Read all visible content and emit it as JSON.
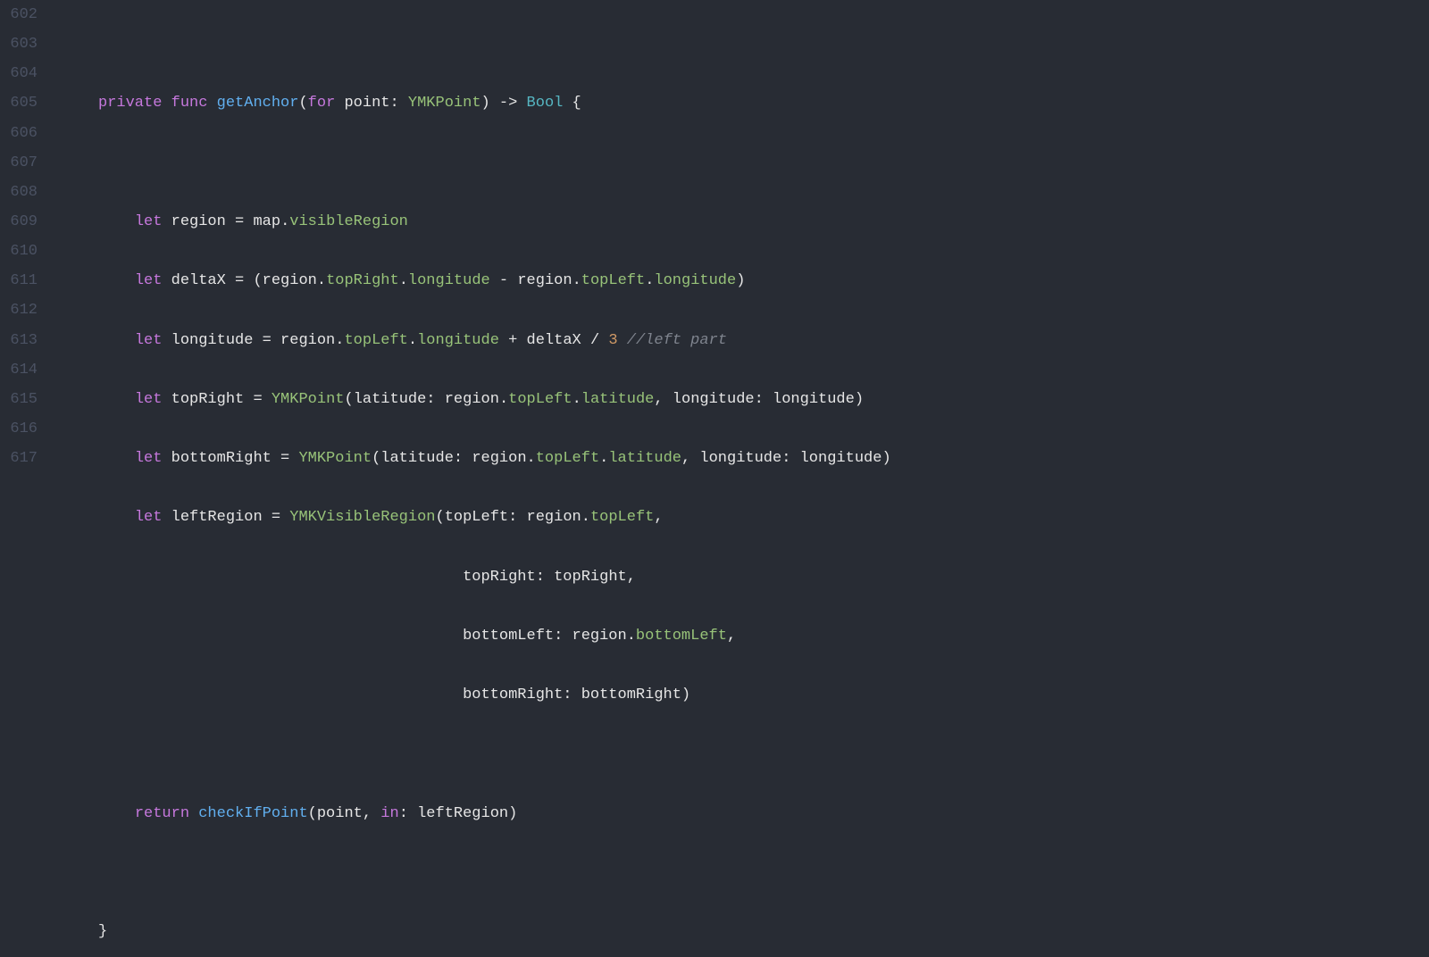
{
  "lineNumbers": [
    "602",
    "603",
    "604",
    "605",
    "606",
    "607",
    "608",
    "609",
    "610",
    "611",
    "612",
    "613",
    "614",
    "615",
    "616",
    "617"
  ],
  "tokens": {
    "l603": {
      "kw1": "private",
      "kw2": "func",
      "fn": "getAnchor",
      "p1": "(",
      "forKw": "for",
      "param": " point",
      "colon": ": ",
      "type1": "YMKPoint",
      "p2": ")",
      "arrow": " -> ",
      "type2": "Bool",
      "brace": " {"
    },
    "l605": {
      "let": "let",
      "name": " region ",
      "eq": "=",
      "obj": " map",
      "dot": ".",
      "prop": "visibleRegion"
    },
    "l606": {
      "let": "let",
      "name": " deltaX ",
      "eq": "=",
      "sp": " ",
      "p1": "(",
      "r1": "region",
      "d1": ".",
      "pr1": "topRight",
      "d2": ".",
      "pr2": "longitude",
      "minus": " - ",
      "r2": "region",
      "d3": ".",
      "pr3": "topLeft",
      "d4": ".",
      "pr4": "longitude",
      "p2": ")"
    },
    "l607": {
      "let": "let",
      "name": " longitude ",
      "eq": "=",
      "sp": " ",
      "r": "region",
      "d1": ".",
      "pr1": "topLeft",
      "d2": ".",
      "pr2": "longitude",
      "plus": " + ",
      "dx": "deltaX",
      "div": " / ",
      "num": "3",
      "sp2": " ",
      "comment": "//left part"
    },
    "l608": {
      "let": "let",
      "name": " topRight ",
      "eq": "= ",
      "type": "YMKPoint",
      "p1": "(",
      "lab1": "latitude: ",
      "r": "region",
      "d1": ".",
      "pr1": "topLeft",
      "d2": ".",
      "pr2": "latitude",
      "comma": ", ",
      "lab2": "longitude: ",
      "val": "longitude",
      "p2": ")"
    },
    "l609": {
      "let": "let",
      "name": " bottomRight ",
      "eq": "= ",
      "type": "YMKPoint",
      "p1": "(",
      "lab1": "latitude: ",
      "r": "region",
      "d1": ".",
      "pr1": "topLeft",
      "d2": ".",
      "pr2": "latitude",
      "comma": ", ",
      "lab2": "longitude: ",
      "val": "longitude",
      "p2": ")"
    },
    "l610": {
      "let": "let",
      "name": " leftRegion ",
      "eq": "= ",
      "type": "YMKVisibleRegion",
      "p1": "(",
      "lab1": "topLeft: ",
      "r": "region",
      "d1": ".",
      "pr1": "topLeft",
      "comma": ","
    },
    "l611": {
      "indent": "                                        ",
      "lab": "topRight: ",
      "val": "topRight",
      "comma": ","
    },
    "l612": {
      "indent": "                                        ",
      "lab": "bottomLeft: ",
      "r": "region",
      "d": ".",
      "pr": "bottomLeft",
      "comma": ","
    },
    "l613": {
      "indent": "                                        ",
      "lab": "bottomRight: ",
      "val": "bottomRight",
      "p": ")"
    },
    "l615": {
      "ret": "return",
      "sp": " ",
      "fn": "checkIfPoint",
      "p1": "(",
      "arg1": "point",
      "comma": ", ",
      "inKw": "in",
      "colon": ": ",
      "arg2": "leftRegion",
      "p2": ")"
    },
    "l617": {
      "brace": "}"
    }
  }
}
